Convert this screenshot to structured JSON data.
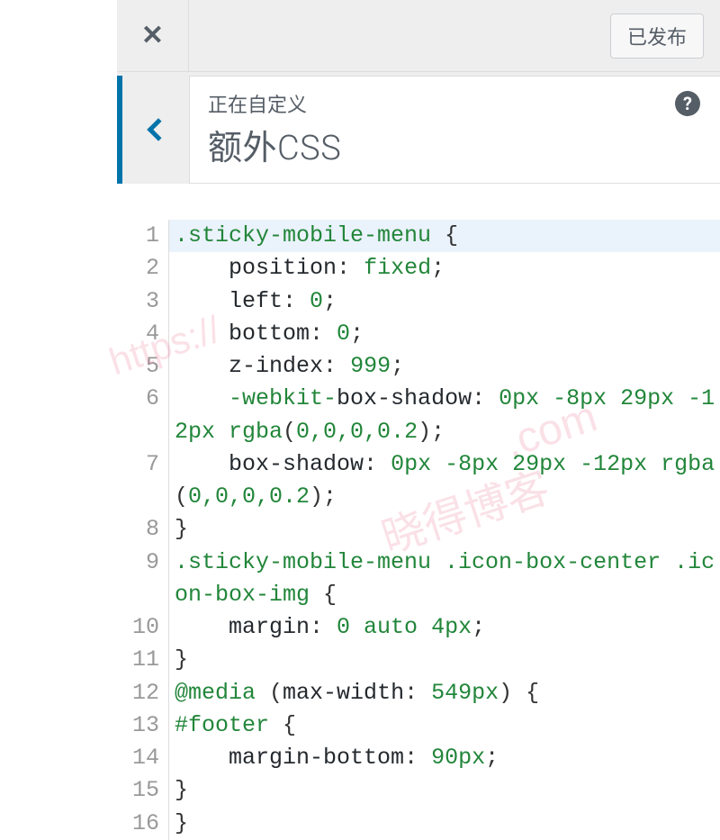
{
  "header": {
    "publish_status": "已发布",
    "customizing_label": "正在自定义",
    "section_title": "额外CSS",
    "help_symbol": "?"
  },
  "code_lines": [
    {
      "n": 1,
      "segments": [
        {
          "t": ".sticky-mobile-menu ",
          "c": "sel"
        },
        {
          "t": "{",
          "c": "pun"
        }
      ]
    },
    {
      "n": 2,
      "segments": [
        {
          "t": "    ",
          "c": "pun"
        },
        {
          "t": "position",
          "c": "prop"
        },
        {
          "t": ": ",
          "c": "pun"
        },
        {
          "t": "fixed",
          "c": "val"
        },
        {
          "t": ";",
          "c": "pun"
        }
      ]
    },
    {
      "n": 3,
      "segments": [
        {
          "t": "    ",
          "c": "pun"
        },
        {
          "t": "left",
          "c": "prop"
        },
        {
          "t": ": ",
          "c": "pun"
        },
        {
          "t": "0",
          "c": "val"
        },
        {
          "t": ";",
          "c": "pun"
        }
      ]
    },
    {
      "n": 4,
      "segments": [
        {
          "t": "    ",
          "c": "pun"
        },
        {
          "t": "bottom",
          "c": "prop"
        },
        {
          "t": ": ",
          "c": "pun"
        },
        {
          "t": "0",
          "c": "val"
        },
        {
          "t": ";",
          "c": "pun"
        }
      ]
    },
    {
      "n": 5,
      "segments": [
        {
          "t": "    ",
          "c": "pun"
        },
        {
          "t": "z-index",
          "c": "prop"
        },
        {
          "t": ": ",
          "c": "pun"
        },
        {
          "t": "999",
          "c": "val"
        },
        {
          "t": ";",
          "c": "pun"
        }
      ]
    },
    {
      "n": 6,
      "segments": [
        {
          "t": "    ",
          "c": "pun"
        },
        {
          "t": "-webkit-",
          "c": "val"
        },
        {
          "t": "box-shadow",
          "c": "prop"
        },
        {
          "t": ": ",
          "c": "pun"
        },
        {
          "t": "0px -8px 29px -12px rgba",
          "c": "val"
        },
        {
          "t": "(",
          "c": "pun"
        },
        {
          "t": "0,0,0,0.2",
          "c": "val"
        },
        {
          "t": ");",
          "c": "pun"
        }
      ]
    },
    {
      "n": 7,
      "segments": [
        {
          "t": "    ",
          "c": "pun"
        },
        {
          "t": "box-shadow",
          "c": "prop"
        },
        {
          "t": ": ",
          "c": "pun"
        },
        {
          "t": "0px -8px 29px -12px rgba",
          "c": "val"
        },
        {
          "t": "(",
          "c": "pun"
        },
        {
          "t": "0,0,0,0.2",
          "c": "val"
        },
        {
          "t": ");",
          "c": "pun"
        }
      ]
    },
    {
      "n": 8,
      "segments": [
        {
          "t": "}",
          "c": "pun"
        }
      ]
    },
    {
      "n": 9,
      "segments": [
        {
          "t": ".sticky-mobile-menu .icon-box-center .icon-box-img ",
          "c": "sel"
        },
        {
          "t": "{",
          "c": "pun"
        }
      ]
    },
    {
      "n": 10,
      "segments": [
        {
          "t": "    ",
          "c": "pun"
        },
        {
          "t": "margin",
          "c": "prop"
        },
        {
          "t": ": ",
          "c": "pun"
        },
        {
          "t": "0 auto 4px",
          "c": "val"
        },
        {
          "t": ";",
          "c": "pun"
        }
      ]
    },
    {
      "n": 11,
      "segments": [
        {
          "t": "}",
          "c": "pun"
        }
      ]
    },
    {
      "n": 12,
      "segments": [
        {
          "t": "@media ",
          "c": "kw"
        },
        {
          "t": "(",
          "c": "pun"
        },
        {
          "t": "max-width",
          "c": "prop"
        },
        {
          "t": ": ",
          "c": "pun"
        },
        {
          "t": "549px",
          "c": "val"
        },
        {
          "t": ") {",
          "c": "pun"
        }
      ]
    },
    {
      "n": 13,
      "segments": [
        {
          "t": "#footer ",
          "c": "sel"
        },
        {
          "t": "{",
          "c": "pun"
        }
      ]
    },
    {
      "n": 14,
      "segments": [
        {
          "t": "    ",
          "c": "pun"
        },
        {
          "t": "margin-bottom",
          "c": "prop"
        },
        {
          "t": ": ",
          "c": "pun"
        },
        {
          "t": "90px",
          "c": "val"
        },
        {
          "t": ";",
          "c": "pun"
        }
      ]
    },
    {
      "n": 15,
      "segments": [
        {
          "t": "}",
          "c": "pun"
        }
      ]
    },
    {
      "n": 16,
      "segments": [
        {
          "t": "}",
          "c": "pun"
        }
      ]
    }
  ],
  "watermarks": {
    "wm1": "https://",
    "wm2": ".com",
    "wm3": "晓得博客"
  }
}
